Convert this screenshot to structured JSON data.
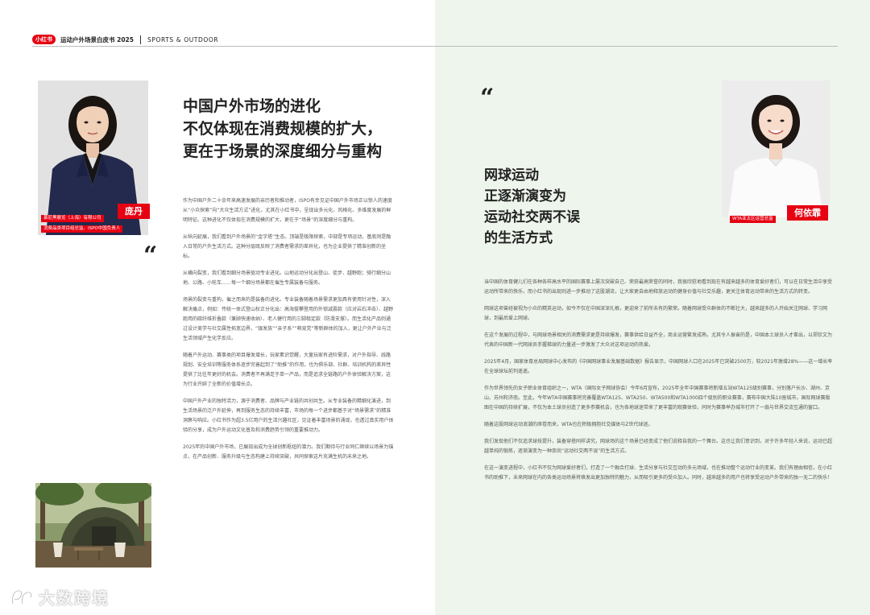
{
  "header": {
    "brand": "小红书",
    "title": "运动户外场景白皮书 2025",
    "subtitle": "SPORTS & OUTDOOR"
  },
  "left": {
    "person": {
      "name": "庞丹",
      "caption_lines": [
        "慕尼黑展览（上海）有限公司",
        "消费品类项目组总监、ISPO中国负责人"
      ]
    },
    "headline": [
      "中国户外市场的进化",
      "不仅体现在消费规模的扩大，",
      "更在于场景的深度细分与重构"
    ],
    "quote_mark": "“",
    "paragraphs": [
      "作为中国户外二十余年来高速发展的亲历者和推动者，ISPO有幸见证中国户外市场正以惊人的速度从“小众探索”向“大众生活方式”进化，尤其在小红书中，呈现出多元化、风格化、多维度发展的鲜明特征。这种进化不仅体现在消费规模的扩大，更在于“场景”的深度细分与重构。",
      "从纵向延展，我们看到户外场景的“金字塔”生态。顶端是极限探索，中部是专项运动，基底则是融入日常的户外生活方式。这种分层既反映了消费者需求的差异化，也为企业提供了精准创新的坐标。",
      "从横向裂变，我们看到细分场景驱动专业进化。山地运动分化出登山、徒步、越野跑；骑行细分山地、公路、小轮车……每一个细分场景都在催生专属装备与服务。",
      "场景的裂变与重构，催之而来的是装备的进化。专业装备随着场景需求更加具有使用针对性，深入解决痛点，例如：传统一体式登山杖正分化出：高海拔攀登用的外锁减震款（应对岩石冲击）、越野跑用的碳纤维折叠款（兼顾快速收纳）、老人健行用的三脚稳定款（防滑支撑）。而生活化产品则通过设计美学与社交属性拓宽边界，“银发族”“亲子系”“萌宠党”等新群体的加入，更让户外产业与泛生活领域产生化学反应。",
      "随着户外运动、赛事类的项目爆发增长，玩家素识觉醒，大量玩家有进阶需求，对户外指导、线路规划、安全培训等服务体系逐步完善起到了“助推”的作用，也为俱乐部、社群、培训机构的差异性提供了比往年更好的机会。消费者不再满足于单一产品，而是追求全链路的户外体验解决方案，这为行业开辟了全新的价值增长点。",
      "中国户外产业的独特活力，源于消费者、品牌与产业链的共创共生。从专业装备的精细化演进，到生活场景的泛户外延伸，再到服务生态的持续丰富，市场的每一个进步都基于对“场景需求”的精准洞察与响应。小红书作为超3.5亿用户的生活兴趣社区，见证着丰富场景的涌现，也透过真实用户体验的分享，成为户外运动文化普及和消费趋势引领的重要推动力。",
      "2025年的中国户外市场，已展现出成为全球创新枢纽的潜力。我们期待与行业同仁继续以场景为锚点，在产品创新、服务升级与生态构建上持续突破，共同探索这片充满生机的未来之地。"
    ]
  },
  "right": {
    "person": {
      "name": "何依霏",
      "caption_lines": [
        "WTA亚太区运营总监"
      ]
    },
    "headline": [
      "网球运动",
      "正逐渐演变为",
      "运动社交两不误",
      "的生活方式"
    ],
    "quote_mark": "“",
    "paragraphs": [
      "当中国的体育健儿们在各种各样高水平的国际赛事上屡次突破自己、荣获最高荣誉的同时，我很欣慰地看到现在有越来越多的体育爱好者们，可以在日常生活中享受运动所带来的快乐，而小红书的出现则进一步推动了这股潮流，让大家更自由地释放运动的健身价值与社交乐趣，更关注体育运动带来的生活方式的转变。",
      "网球这项曾经被视为小众的精英运动，如今不仅在中国深深扎根，更迎来了前所未有的繁荣。随着网球受众群体的不断壮大，越来越多的人开始关注网球、学习网球，到最后爱上网球。",
      "在这个发展的过程中，与网球场景相关的消费需求更是持续爆发，赛事供给日益齐全，商业运营繁发成熟。尤其令人振奋的是，中国本土球员人才辈出，以郑钦文为代表的中国新一代网球员手握梯球的力量进一步激发了大众对这项运动的热爱。",
      "2025年4月，国家体育总局网球中心发布的《中国网球事业发展基础数据》报告显示，中国网球人口在2025年已突破2500万，较2021年激增28%——这一增长率在全球球坛前列遥遥。",
      "作为世界领先的女子职业体育组织之一，WTA（国际女子网球协会）今年6月宣布，2025年全年中国赛事将新增五站WTA125级别赛事，分别落户长沙、湖州、京山、苏州和济南。至此，今年WTA中国赛事将完善覆盖WTA125、WTA250、WTA500和WTA1000四个级别的职业赛事，赛布中国大陆10座城市。国际网球赛版图在中国的持续扩展，不仅为本土球员创造了更多参赛机会，也为各地球迷带来了更丰富的观赛体验，同时为赛事举办城市打开了一扇与世界交流互通的窗口。",
      "随着这股网球运动浪潮的席卷而来，WTA也在积极拥抱社交媒体与Z世代球迷。",
      "我们发现他们不仅追求球技提升，装备穿搭同样讲究，网球场的这个场景已经变成了他们说释自我的一个舞台。这也让我们意识到，对于许多年轻人来说，运动已超越单纯的锻炼，逐渐演变为一种崇尚“运动社交两不误”的生活方式。",
      "在这一演变进程中，小红书不仅为网球爱好者们，打造了一个融合打球、生活分享与社交互动的多元场域，也在推动整个运动行业的变革。我们有理由相信，在小红书的助推下，未来网球在内的各类运动场景将焕发出更加独特的魅力，从而吸引更多的受众加入。同时，越来越多的用户也将享受运动户外带来的独一无二的快乐！"
    ]
  },
  "watermark": {
    "text": "大数跨境"
  },
  "colors": {
    "accent": "#e60012",
    "right_bg": "#eef5ec"
  }
}
